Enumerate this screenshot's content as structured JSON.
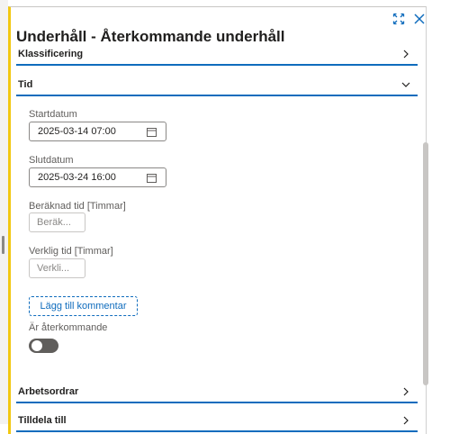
{
  "panel": {
    "title": "Underhåll - Återkommande underhåll",
    "sections": {
      "klassificering": "Klassificering",
      "tid": "Tid",
      "arbetsordrar": "Arbetsordrar",
      "tilldela": "Tilldela till"
    },
    "fields": {
      "startdatum": {
        "label": "Startdatum",
        "value": "2025-03-14 07:00"
      },
      "slutdatum": {
        "label": "Slutdatum",
        "value": "2025-03-24 16:00"
      },
      "beraknad_tid": {
        "label": "Beräknad tid [Timmar]",
        "placeholder": "Beräk..."
      },
      "verklig_tid": {
        "label": "Verklig tid [Timmar]",
        "placeholder": "Verkli..."
      }
    },
    "add_comment_label": "Lägg till kommentar",
    "recurring": {
      "label": "Är återkommande",
      "value": false
    }
  },
  "colors": {
    "accent": "#0f6cbd",
    "panel_left_border": "#f2c811",
    "toggle_off": "#605e5c"
  },
  "icons": [
    "expand-icon",
    "close-icon",
    "chevron-right-icon",
    "chevron-down-icon",
    "calendar-icon"
  ]
}
